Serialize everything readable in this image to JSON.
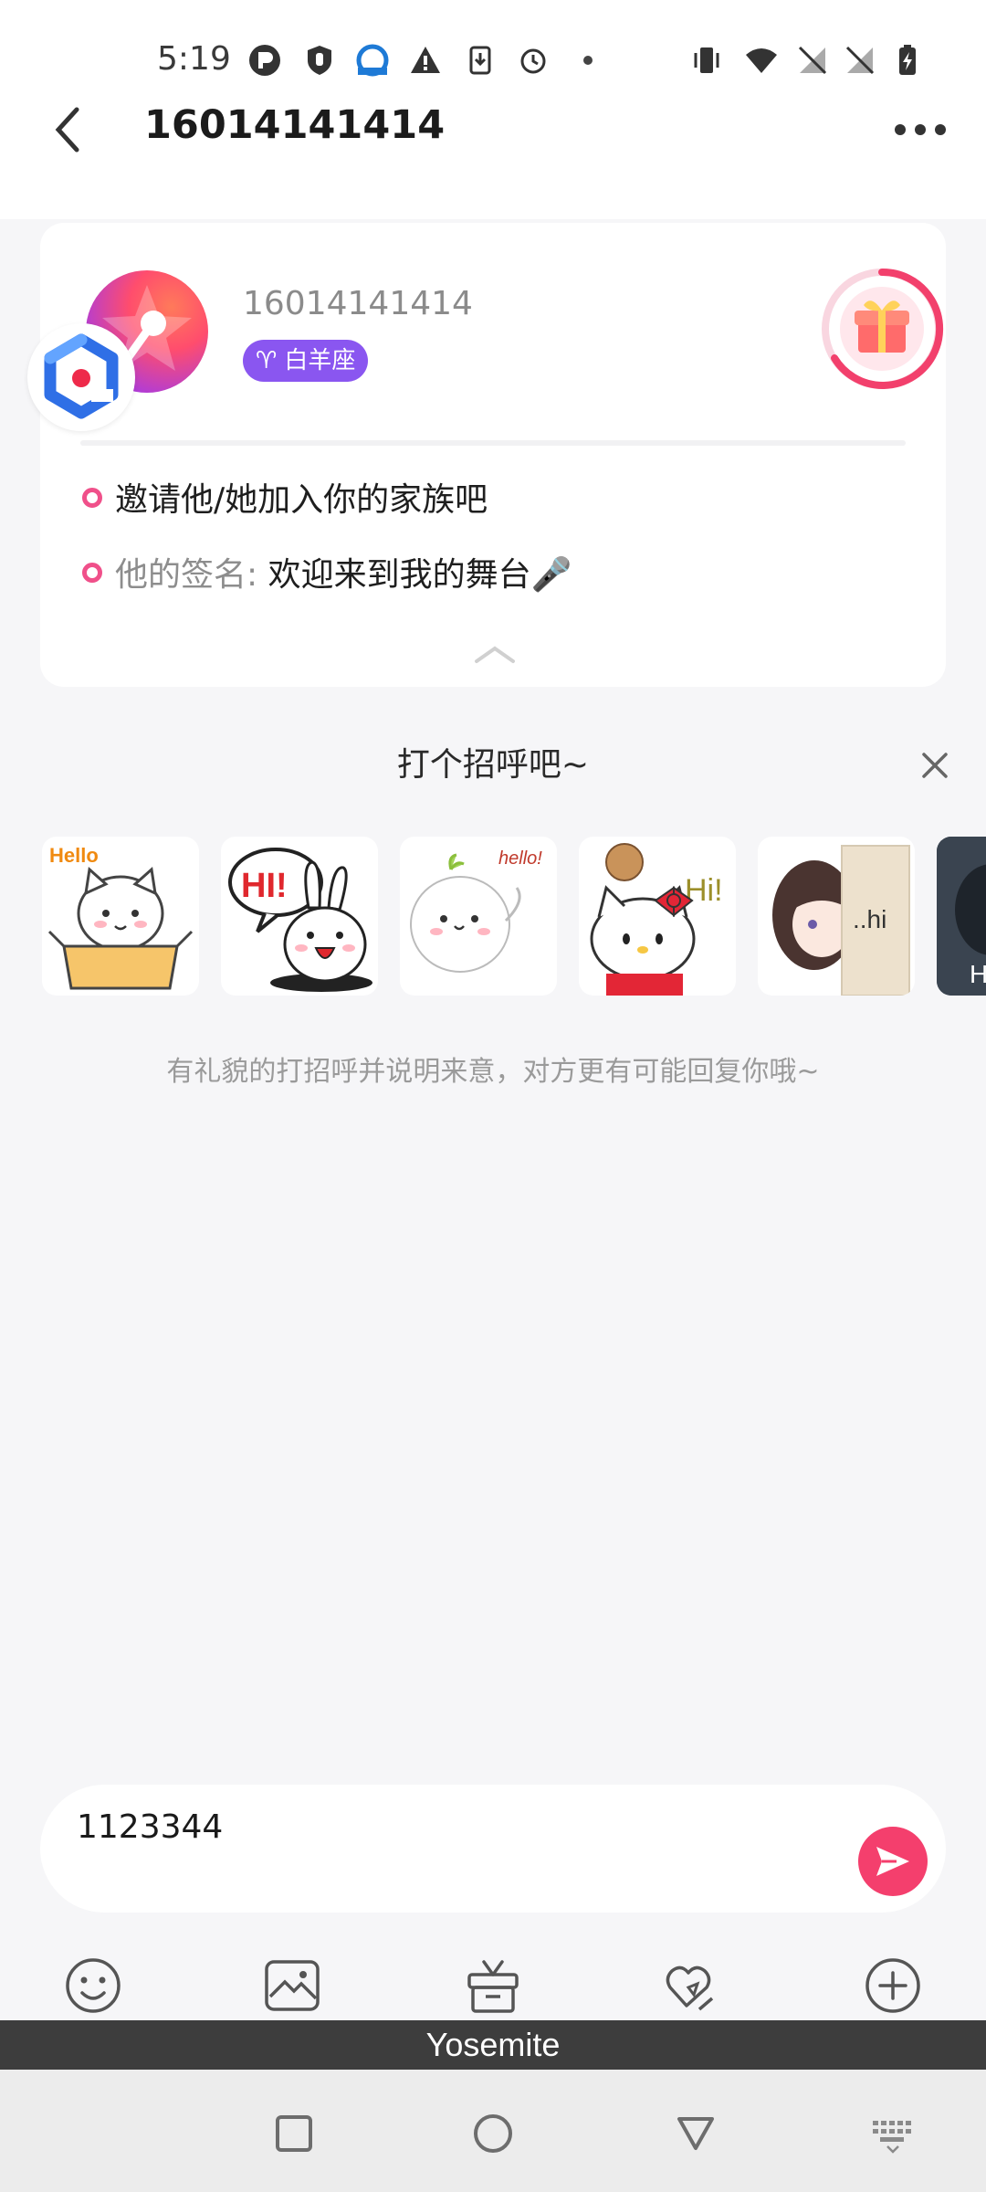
{
  "status_bar": {
    "time": "5:19",
    "icons": [
      "p-icon",
      "shield-icon",
      "browser-icon",
      "warning-icon",
      "download-icon",
      "alarm-icon",
      "dot-icon",
      "vibrate-icon",
      "wifi-icon",
      "no-sim-icon",
      "no-sim-icon",
      "battery-charging-icon"
    ]
  },
  "header": {
    "title": "16014141414",
    "back_icon": "chevron-left-icon",
    "more_icon": "more-dots-icon"
  },
  "profile": {
    "name": "16014141414",
    "zodiac_symbol": "♈",
    "zodiac_label": "白羊座",
    "invite_text": "邀请他/她加入你的家族吧",
    "signature_label": "他的签名:",
    "signature_text": "欢迎来到我的舞台🎤",
    "accent_color": "#f0508a",
    "zodiac_color": "#8a56f0"
  },
  "greeting": {
    "title": "打个招呼吧~",
    "hint": "有礼貌的打招呼并说明来意，对方更有可能回复你哦~",
    "stickers": [
      {
        "name": "cat-hello-sticker",
        "caption": "Hello"
      },
      {
        "name": "bunny-hi-sticker",
        "caption": "HI!"
      },
      {
        "name": "dumpling-hello-sticker",
        "caption": "hello!"
      },
      {
        "name": "kitty-hi-sticker",
        "caption": "Hi!"
      },
      {
        "name": "girl-hi-sticker",
        "caption": "..hi"
      },
      {
        "name": "photo-sticker",
        "caption": "H"
      }
    ]
  },
  "composer": {
    "input_value": "1123344",
    "send_color": "#f43f6d"
  },
  "toolbar": {
    "icons": [
      "emoji-icon",
      "image-icon",
      "gift-icon",
      "hearts-icon",
      "plus-icon"
    ]
  },
  "keyboard_bar": {
    "label": "Yosemite"
  },
  "nav": {
    "icons": [
      "recents-square-icon",
      "home-circle-icon",
      "back-triangle-icon",
      "keyboard-icon"
    ]
  }
}
